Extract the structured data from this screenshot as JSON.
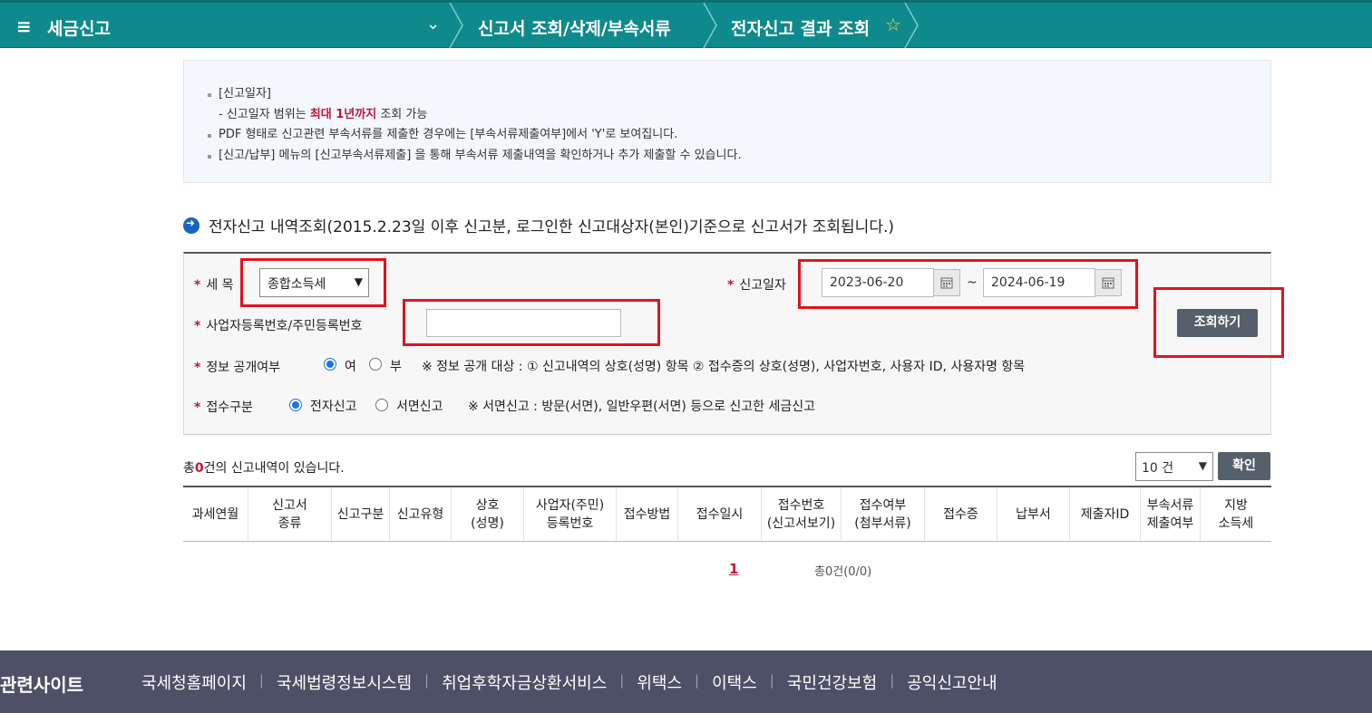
{
  "topbar": {
    "title": "세금신고",
    "crumb1": "신고서 조회/삭제/부속서류",
    "crumb2": "전자신고 결과 조회"
  },
  "notice": {
    "line1": "[신고일자]",
    "line2_prefix": "- 신고일자 범위는 ",
    "line2_highlight": "최대 1년까지",
    "line2_suffix": " 조회 가능",
    "line3": "PDF 형태로 신고관련 부속서류를 제출한 경우에는 [부속서류제출여부]에서 'Y'로 보여집니다.",
    "line4": "[신고/납부] 메뉴의 [신고부속서류제출] 을 통해 부속서류 제출내역을 확인하거나 추가 제출할 수 있습니다."
  },
  "section_title": "전자신고 내역조회(2015.2.23일 이후 신고분, 로그인한  신고대상자(본인)기준으로  신고서가 조회됩니다.)",
  "form": {
    "tax_item_label": "세 목",
    "tax_item_value": "종합소득세",
    "date_label": "신고일자",
    "date_from": "2023-06-20",
    "date_to": "2024-06-19",
    "tilde": "~",
    "reg_no_label": "사업자등록번호/주민등록번호",
    "reg_no_value": "",
    "search_button": "조회하기",
    "disclosure_label": "정보 공개여부",
    "disclosure_yes": "여",
    "disclosure_no": "부",
    "disclosure_note": "※ 정보 공개 대상 : ① 신고내역의 상호(성명) 항목 ② 접수증의 상호(성명), 사업자번호, 사용자 ID, 사용자명 항목",
    "receipt_label": "접수구분",
    "receipt_electronic": "전자신고",
    "receipt_paper": "서면신고",
    "receipt_note": "※ 서면신고 : 방문(서면), 일반우편(서면) 등으로 신고한 세금신고"
  },
  "results": {
    "total_prefix": "총",
    "total_count": "0",
    "total_suffix": "건의 신고내역이 있습니다.",
    "page_size": "10 건",
    "confirm_button": "확인",
    "columns": [
      {
        "l1": "과세연월",
        "l2": ""
      },
      {
        "l1": "신고서",
        "l2": "종류"
      },
      {
        "l1": "신고구분",
        "l2": ""
      },
      {
        "l1": "신고유형",
        "l2": ""
      },
      {
        "l1": "상호",
        "l2": "(성명)"
      },
      {
        "l1": "사업자(주민)",
        "l2": "등록번호"
      },
      {
        "l1": "접수방법",
        "l2": ""
      },
      {
        "l1": "접수일시",
        "l2": ""
      },
      {
        "l1": "접수번호",
        "l2": "(신고서보기)"
      },
      {
        "l1": "접수여부",
        "l2": "(첨부서류)"
      },
      {
        "l1": "접수증",
        "l2": ""
      },
      {
        "l1": "납부서",
        "l2": ""
      },
      {
        "l1": "제출자ID",
        "l2": ""
      },
      {
        "l1": "부속서류",
        "l2": "제출여부"
      },
      {
        "l1": "지방",
        "l2": "소득세"
      }
    ],
    "page_number": "1",
    "page_count": "총0건(0/0)"
  },
  "footer": {
    "title": "관련사이트",
    "links": [
      "국세청홈페이지",
      "국세법령정보시스템",
      "취업후학자금상환서비스",
      "위택스",
      "이택스",
      "국민건강보험",
      "공익신고안내"
    ]
  },
  "colors": {
    "topbar": "#0f8a8c",
    "highlight": "#c0143c",
    "annotation_box": "#e0141e",
    "footer": "#4d5067"
  }
}
